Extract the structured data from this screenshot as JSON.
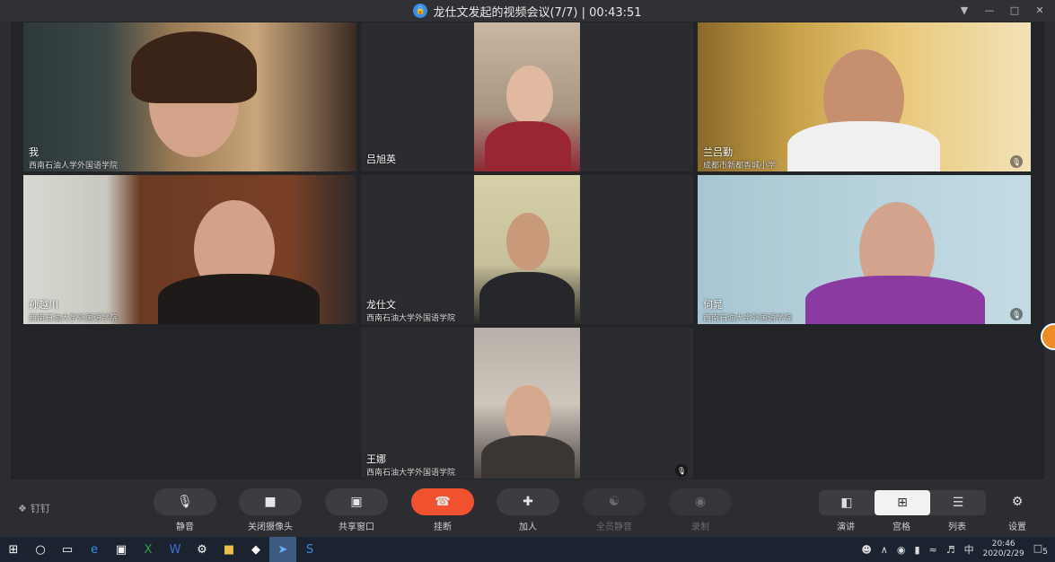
{
  "window": {
    "title": "龙仕文发起的视频会议(7/7) | 00:43:51",
    "pin_icon": "pin-icon",
    "minimize_icon": "minimize-icon",
    "maximize_icon": "maximize-icon",
    "close_icon": "close-icon"
  },
  "participants": [
    {
      "name": "我",
      "org": "西南石油人学外国语学院",
      "muted": false
    },
    {
      "name": "吕旭英",
      "org": "",
      "muted": false
    },
    {
      "name": "兰吕勤",
      "org": "成都市新都香城小学",
      "muted": true
    },
    {
      "name": "孙越川",
      "org": "西南石油大学外国语学院",
      "muted": false
    },
    {
      "name": "龙仕文",
      "org": "西南石油大学外国语学院",
      "muted": false
    },
    {
      "name": "何晁",
      "org": "西南石油大学外国语学院",
      "muted": true
    },
    {
      "name": "王娜",
      "org": "西南石油大学外国语学院",
      "muted": true
    }
  ],
  "toolbar": {
    "brand": "钉钉",
    "buttons": [
      {
        "label": "静音",
        "icon": "microphone-icon"
      },
      {
        "label": "关闭摄像头",
        "icon": "camera-icon"
      },
      {
        "label": "共享窗口",
        "icon": "share-screen-icon"
      },
      {
        "label": "挂断",
        "icon": "hang-up-icon"
      },
      {
        "label": "加人",
        "icon": "add-person-icon"
      },
      {
        "label": "全员静音",
        "icon": "mute-all-icon"
      },
      {
        "label": "录制",
        "icon": "record-icon"
      }
    ],
    "views": [
      {
        "label": "演讲",
        "icon": "speaker-view-icon"
      },
      {
        "label": "宫格",
        "icon": "grid-view-icon"
      },
      {
        "label": "列表",
        "icon": "list-view-icon"
      }
    ],
    "settings_label": "设置"
  },
  "taskbar": {
    "ime": "中",
    "time": "20:46",
    "date": "2020/2/29",
    "notifications": "5"
  },
  "colors": {
    "hangup": "#f0522f",
    "background": "#2b2d30"
  }
}
